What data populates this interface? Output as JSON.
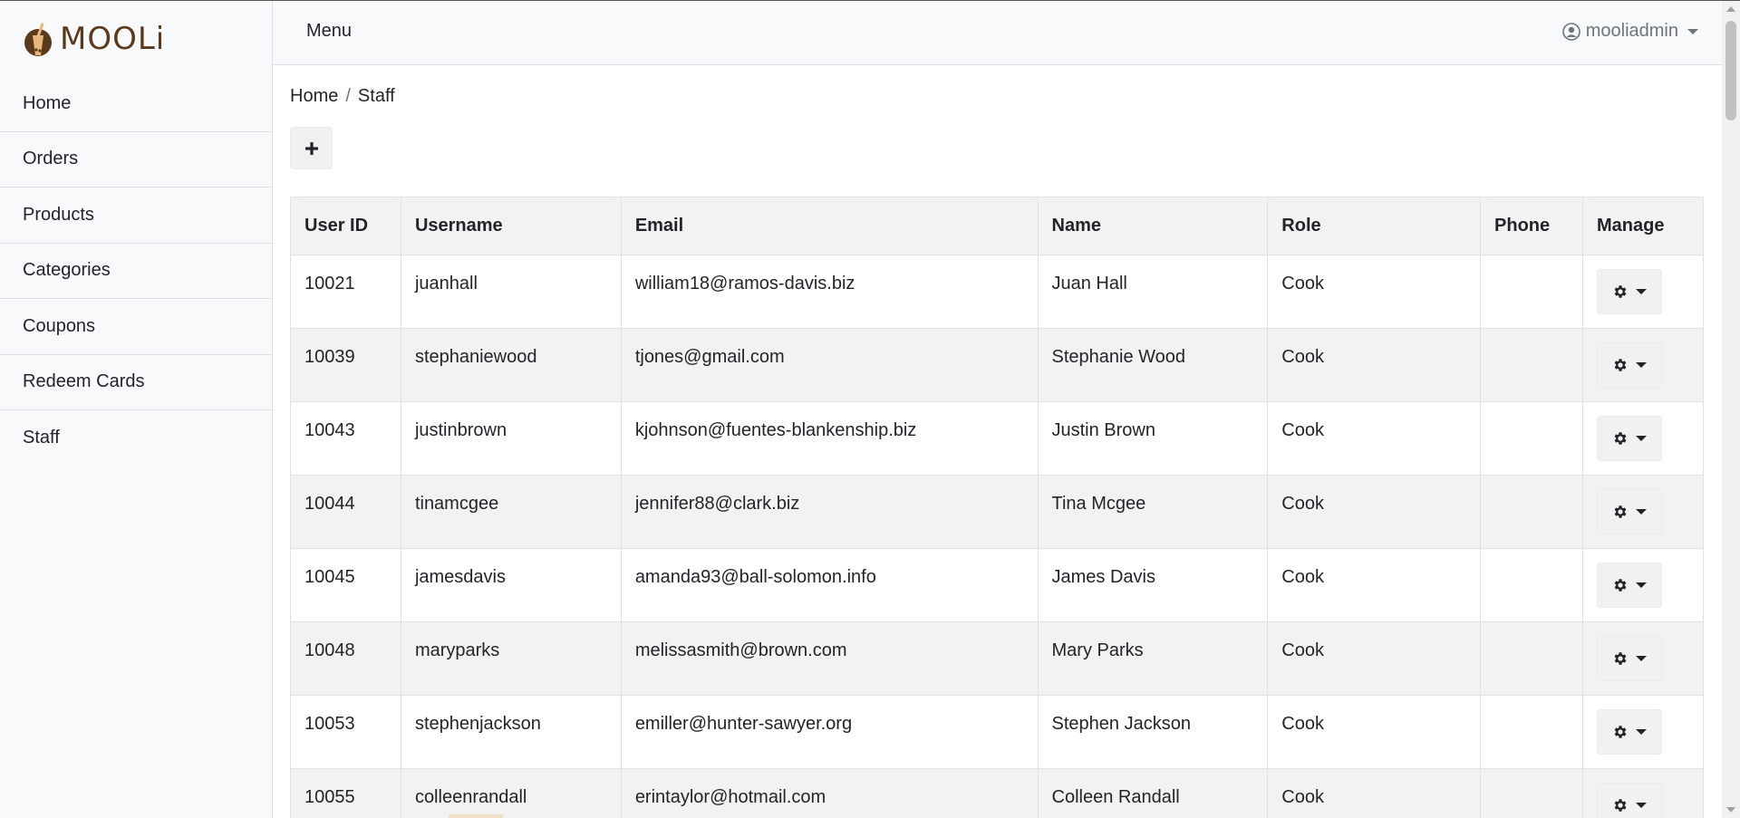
{
  "app": {
    "logo_text": "MOOLi"
  },
  "sidebar": {
    "items": [
      {
        "label": "Home"
      },
      {
        "label": "Orders"
      },
      {
        "label": "Products"
      },
      {
        "label": "Categories"
      },
      {
        "label": "Coupons"
      },
      {
        "label": "Redeem Cards"
      },
      {
        "label": "Staff"
      }
    ]
  },
  "topbar": {
    "menu_label": "Menu",
    "username": "mooliadmin"
  },
  "breadcrumb": {
    "home": "Home",
    "separator": "/",
    "current": "Staff"
  },
  "toolbar": {
    "add_label": "+"
  },
  "table": {
    "headers": [
      "User ID",
      "Username",
      "Email",
      "Name",
      "Role",
      "Phone",
      "Manage"
    ],
    "rows": [
      {
        "id": "10021",
        "username": "juanhall",
        "email": "william18@ramos-davis.biz",
        "name": "Juan Hall",
        "role": "Cook",
        "phone": ""
      },
      {
        "id": "10039",
        "username": "stephaniewood",
        "email": "tjones@gmail.com",
        "name": "Stephanie Wood",
        "role": "Cook",
        "phone": ""
      },
      {
        "id": "10043",
        "username": "justinbrown",
        "email": "kjohnson@fuentes-blankenship.biz",
        "name": "Justin Brown",
        "role": "Cook",
        "phone": ""
      },
      {
        "id": "10044",
        "username": "tinamcgee",
        "email": "jennifer88@clark.biz",
        "name": "Tina Mcgee",
        "role": "Cook",
        "phone": ""
      },
      {
        "id": "10045",
        "username": "jamesdavis",
        "email": "amanda93@ball-solomon.info",
        "name": "James Davis",
        "role": "Cook",
        "phone": ""
      },
      {
        "id": "10048",
        "username": "maryparks",
        "email": "melissasmith@brown.com",
        "name": "Mary Parks",
        "role": "Cook",
        "phone": ""
      },
      {
        "id": "10053",
        "username": "stephenjackson",
        "email": "emiller@hunter-sawyer.org",
        "name": "Stephen Jackson",
        "role": "Cook",
        "phone": ""
      },
      {
        "id": "10055",
        "username": "colleenrandall",
        "email": "erintaylor@hotmail.com",
        "name": "Colleen Randall",
        "role": "Cook",
        "phone": ""
      }
    ]
  },
  "colors": {
    "brand": "#5a3a1a",
    "brand_accent": "#b5651d",
    "sidebar_bg": "#f8f9fa",
    "stripe": "#f2f2f2"
  },
  "icons": {
    "user": "user-circle-icon",
    "gear": "gear-icon",
    "add": "plus-icon",
    "caret": "caret-down-icon"
  }
}
